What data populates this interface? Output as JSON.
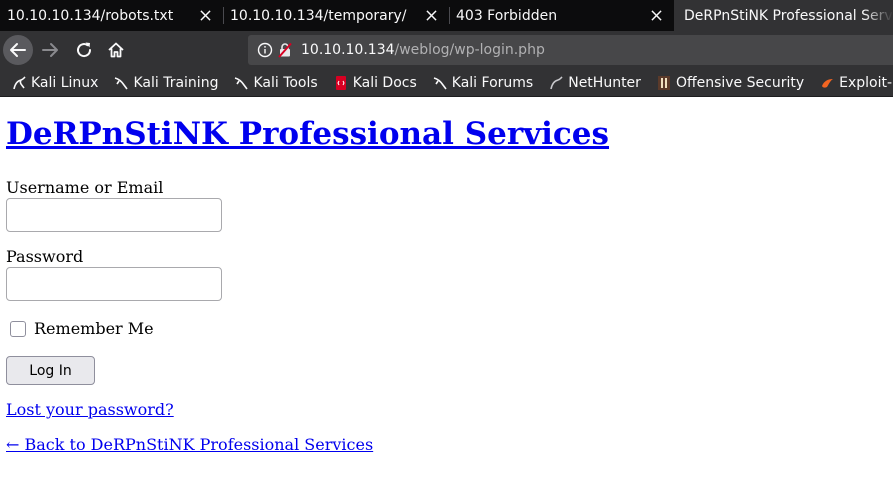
{
  "browser": {
    "tabs": [
      {
        "title": "10.10.10.134/robots.txt",
        "active": false
      },
      {
        "title": "10.10.10.134/temporary/",
        "active": false
      },
      {
        "title": "403 Forbidden",
        "active": false
      },
      {
        "title": "DeRPnStiNK Professional Services",
        "active": true
      }
    ],
    "url": {
      "host": "10.10.10.134",
      "path": "/weblog/wp-login.php"
    },
    "bookmarks": [
      {
        "label": "Kali Linux",
        "icon": "kali-dragon-icon"
      },
      {
        "label": "Kali Training",
        "icon": "kali-dragon-icon"
      },
      {
        "label": "Kali Tools",
        "icon": "kali-dragon-icon"
      },
      {
        "label": "Kali Docs",
        "icon": "kali-docs-icon"
      },
      {
        "label": "Kali Forums",
        "icon": "kali-dragon-icon"
      },
      {
        "label": "NetHunter",
        "icon": "nethunter-icon"
      },
      {
        "label": "Offensive Security",
        "icon": "offsec-icon"
      },
      {
        "label": "Exploit-DB",
        "icon": "exploit-db-icon"
      }
    ]
  },
  "page": {
    "site_title": "DeRPnStiNK Professional Services",
    "username_label": "Username or Email",
    "username_value": "",
    "password_label": "Password",
    "password_value": "",
    "remember_label": "Remember Me",
    "remember_checked": false,
    "login_button": "Log In",
    "lost_password_link": "Lost your password?",
    "back_link": "← Back to DeRPnStiNK Professional Services"
  },
  "colors": {
    "chrome_dark": "#0c0c0d",
    "toolbar": "#323234",
    "urlbar": "#474749",
    "link": "#0000ee",
    "insecure_lock": "#d70022"
  }
}
